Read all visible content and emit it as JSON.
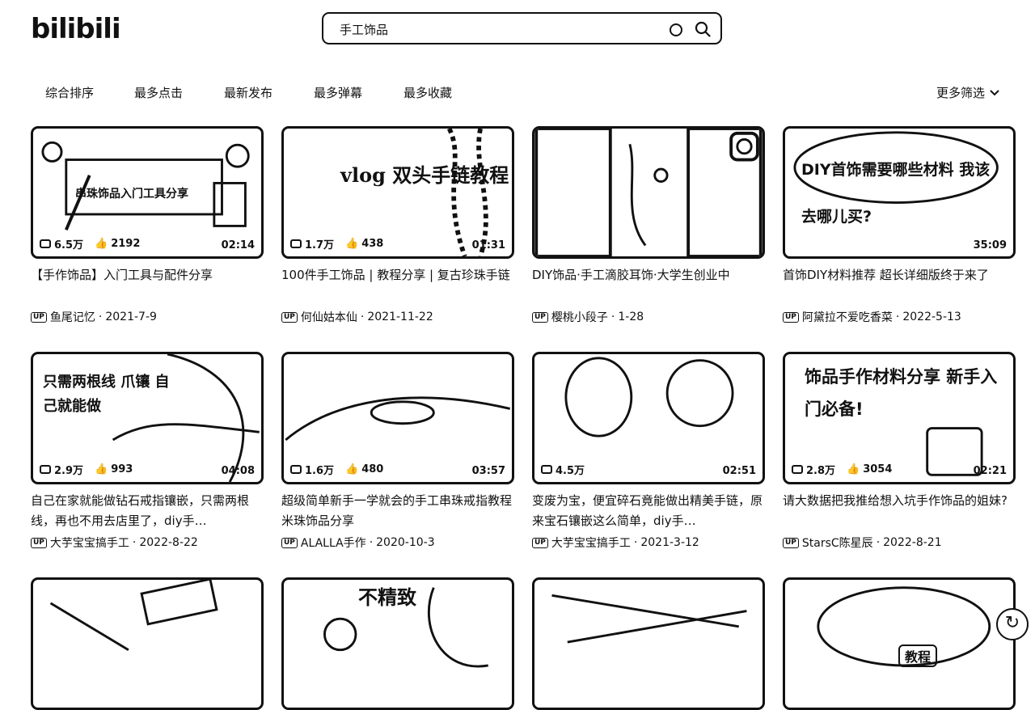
{
  "logo": "bilibili",
  "search": {
    "value": "手工饰品"
  },
  "filters": [
    "综合排序",
    "最多点击",
    "最新发布",
    "最多弹幕",
    "最多收藏"
  ],
  "more_filter": "更多筛选",
  "videos": [
    {
      "title": "【手作饰品】入门工具与配件分享",
      "views": "6.5万",
      "likes": "2192",
      "duration": "02:14",
      "uploader": "鱼尾记忆",
      "date": "2021-7-9",
      "overlay": "串珠饰品入门工具分享"
    },
    {
      "title": "100件手工饰品 | 教程分享 | 复古珍珠手链",
      "views": "1.7万",
      "likes": "438",
      "duration": "01:31",
      "uploader": "何仙姑本仙",
      "date": "2021-11-22",
      "overlay": "vlog 双头手链教程"
    },
    {
      "title": "DIY饰品·手工滴胶耳饰·大学生创业中",
      "views": "",
      "likes": "",
      "duration": "",
      "uploader": "樱桃小段子",
      "date": "1-28",
      "overlay": ""
    },
    {
      "title": "首饰DIY材料推荐 超长详细版终于来了",
      "views": "",
      "likes": "",
      "duration": "35:09",
      "uploader": "阿黛拉不爱吃香菜",
      "date": "2022-5-13",
      "overlay": "DIY首饰需要哪些材料 我该去哪儿买?"
    },
    {
      "title": "自己在家就能做钻石戒指镶嵌，只需两根线，再也不用去店里了，diy手…",
      "views": "2.9万",
      "likes": "993",
      "duration": "04:08",
      "uploader": "大芋宝宝搞手工",
      "date": "2022-8-22",
      "overlay": "只需两根线 爪镶 自己就能做"
    },
    {
      "title": "超级简单新手一学就会的手工串珠戒指教程米珠饰品分享",
      "views": "1.6万",
      "likes": "480",
      "duration": "03:57",
      "uploader": "ALALLA手作",
      "date": "2020-10-3",
      "overlay": ""
    },
    {
      "title": "变废为宝，便宜碎石竟能做出精美手链，原来宝石镶嵌这么简单，diy手…",
      "views": "4.5万",
      "likes": "",
      "duration": "02:51",
      "uploader": "大芋宝宝搞手工",
      "date": "2021-3-12",
      "overlay": ""
    },
    {
      "title": "请大数据把我推给想入坑手作饰品的姐妹?",
      "views": "2.8万",
      "likes": "3054",
      "duration": "02:21",
      "uploader": "StarsC陈星辰",
      "date": "2022-8-21",
      "overlay": "饰品手作材料分享 新手入门必备!"
    },
    {
      "title": "",
      "views": "",
      "likes": "",
      "duration": "",
      "uploader": "",
      "date": "",
      "overlay": ""
    },
    {
      "title": "",
      "views": "",
      "likes": "",
      "duration": "",
      "uploader": "",
      "date": "",
      "overlay": "不精致"
    },
    {
      "title": "",
      "views": "",
      "likes": "",
      "duration": "",
      "uploader": "",
      "date": "",
      "overlay": ""
    },
    {
      "title": "",
      "views": "",
      "likes": "",
      "duration": "",
      "uploader": "",
      "date": "",
      "overlay": "教程"
    }
  ],
  "icons": {
    "play": "play-count-icon",
    "like": "like-icon",
    "up": "up-badge-icon",
    "refresh": "refresh-icon"
  }
}
